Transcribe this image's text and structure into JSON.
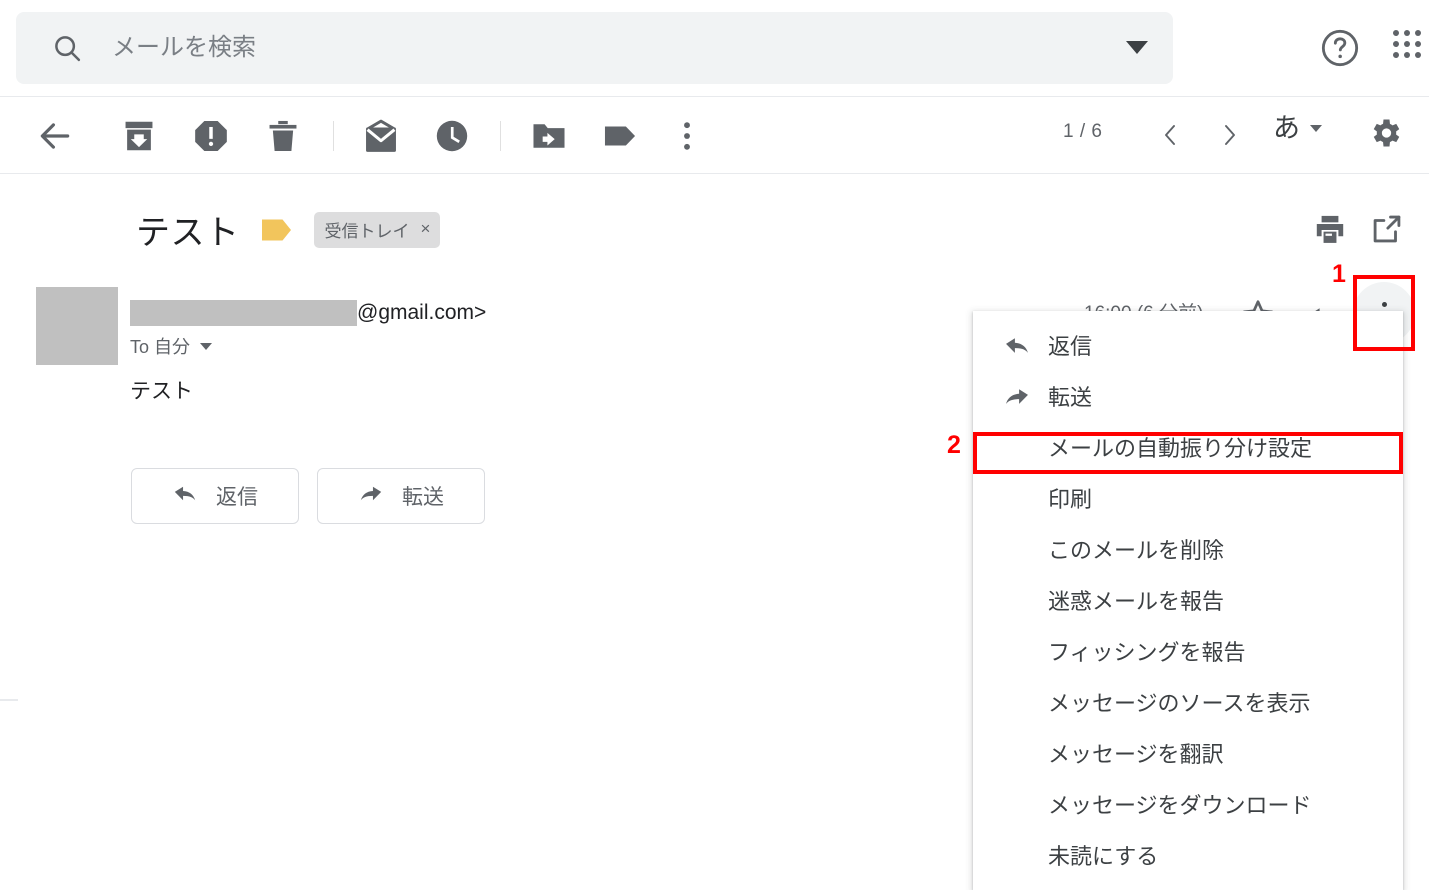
{
  "search": {
    "placeholder": "メールを検索",
    "value": "",
    "icon": "search-icon",
    "dropdown_icon": "chevron-down-icon"
  },
  "topbar": {
    "help_icon": "help-circle-icon",
    "apps_icon": "apps-grid-icon"
  },
  "toolbar": {
    "back_icon": "back-arrow-icon",
    "archive_icon": "archive-icon",
    "spam_icon": "report-spam-icon",
    "delete_icon": "trash-icon",
    "mark_unread_icon": "mark-unread-icon",
    "snooze_icon": "snooze-clock-icon",
    "move_to_icon": "move-to-folder-icon",
    "labels_icon": "label-tag-icon",
    "more_icon": "more-vertical-icon",
    "page_count": "1 / 6",
    "prev_icon": "chevron-left-icon",
    "next_icon": "chevron-right-icon",
    "language_glyph": "あ",
    "settings_icon": "gear-icon"
  },
  "subject": {
    "title": "テスト",
    "important_marker_icon": "important-marker-icon",
    "label": "受信トレイ",
    "label_remove": "×",
    "print_icon": "print-icon",
    "popout_icon": "open-in-new-icon"
  },
  "message": {
    "sender_domain": "@gmail.com>",
    "to_label": "To 自分",
    "to_caret_icon": "chevron-down-icon",
    "body": "テスト",
    "timestamp": "16:00 (6 分前)",
    "star_icon": "star-icon",
    "reply_icon": "reply-arrow-icon",
    "more_icon": "more-vertical-icon"
  },
  "actions": [
    {
      "label": "返信",
      "icon": "reply-icon"
    },
    {
      "label": "転送",
      "icon": "forward-icon"
    }
  ],
  "menu": {
    "items": [
      {
        "label": "返信",
        "icon": "reply-icon",
        "highlighted": false
      },
      {
        "label": "転送",
        "icon": "forward-icon",
        "highlighted": false
      },
      {
        "label": "メールの自動振り分け設定",
        "icon": "",
        "highlighted": true
      },
      {
        "label": "印刷",
        "icon": "",
        "highlighted": false
      },
      {
        "label": "このメールを削除",
        "icon": "",
        "highlighted": false
      },
      {
        "label": "迷惑メールを報告",
        "icon": "",
        "highlighted": false
      },
      {
        "label": "フィッシングを報告",
        "icon": "",
        "highlighted": false
      },
      {
        "label": "メッセージのソースを表示",
        "icon": "",
        "highlighted": false
      },
      {
        "label": "メッセージを翻訳",
        "icon": "",
        "highlighted": false
      },
      {
        "label": "メッセージをダウンロード",
        "icon": "",
        "highlighted": false
      },
      {
        "label": "未読にする",
        "icon": "",
        "highlighted": false
      }
    ]
  },
  "annotations": [
    {
      "number": "1",
      "target": "more-options-button"
    },
    {
      "number": "2",
      "target": "menu-item-filter-messages"
    }
  ],
  "colors": {
    "annotation_red": "#ff0000",
    "important_yellow": "#f2c55c",
    "search_bg": "#f1f3f4",
    "icon_gray": "#5f6368",
    "text_primary": "#202124"
  }
}
